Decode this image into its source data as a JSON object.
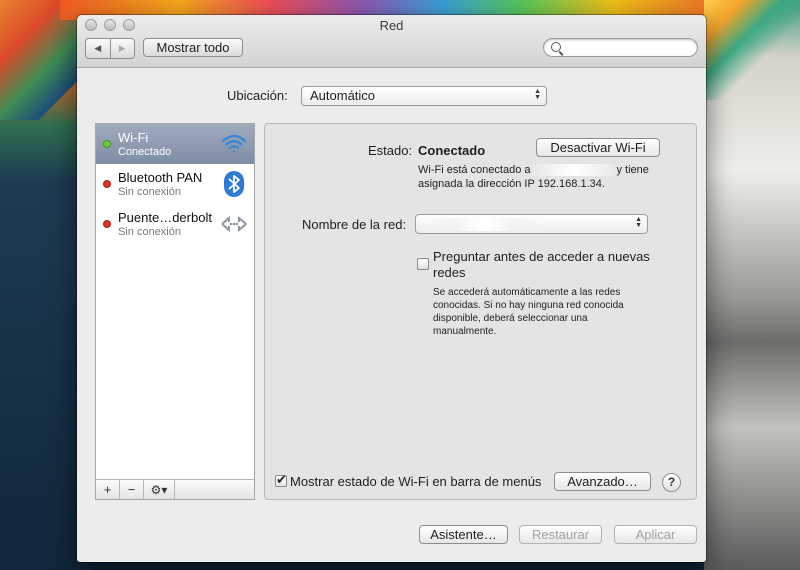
{
  "window": {
    "title": "Red"
  },
  "toolbar": {
    "back_icon": "chevron-left-icon",
    "forward_icon": "chevron-right-icon",
    "show_all_label": "Mostrar todo",
    "search_value": ""
  },
  "location": {
    "label": "Ubicación:",
    "value": "Automático"
  },
  "services": [
    {
      "name": "Wi-Fi",
      "status": "Conectado",
      "status_color": "#6fcf3a",
      "icon": "wifi-icon",
      "selected": true
    },
    {
      "name": "Bluetooth PAN",
      "status": "Sin conexión",
      "status_color": "#e0302a",
      "icon": "bluetooth-icon",
      "selected": false
    },
    {
      "name": "Puente…derbolt",
      "status": "Sin conexión",
      "status_color": "#e0302a",
      "icon": "thunderbolt-bridge-icon",
      "selected": false
    }
  ],
  "sidebar_tools": {
    "add": "+",
    "remove": "−",
    "gear": "⚙▾"
  },
  "detail": {
    "status_label": "Estado:",
    "status_value": "Conectado",
    "toggle_wifi_label": "Desactivar Wi-Fi",
    "status_line1_start": "Wi-Fi está conectado a",
    "status_line1_end": "y tiene",
    "status_line2": "asignada la dirección IP 192.168.1.34.",
    "network_name_label": "Nombre de la red:",
    "network_name_value": "",
    "ask_join_label_1": "Preguntar antes de acceder a nuevas",
    "ask_join_label_2": "redes",
    "ask_join_checked": false,
    "ask_join_help": [
      "Se accederá automáticamente a las redes",
      "conocidas. Si no hay ninguna red conocida",
      "disponible, deberá seleccionar una",
      "manualmente."
    ],
    "show_status_label": "Mostrar estado de Wi-Fi en barra de menús",
    "show_status_checked": true,
    "advanced_label": "Avanzado…",
    "help_label": "?"
  },
  "footer": {
    "assistant_label": "Asistente…",
    "revert_label": "Restaurar",
    "apply_label": "Aplicar"
  }
}
